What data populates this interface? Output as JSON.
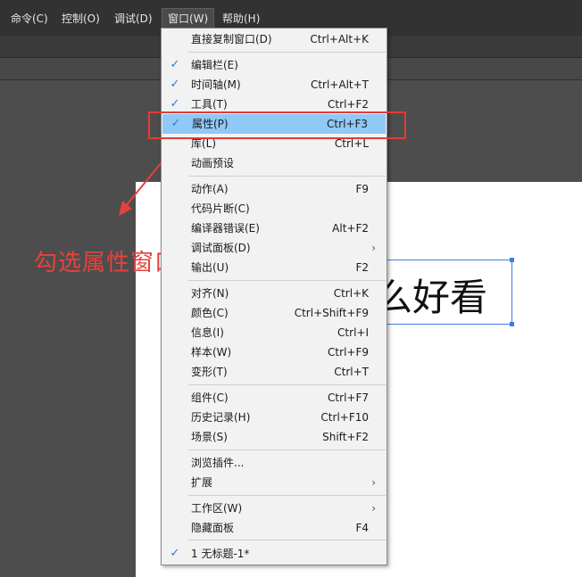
{
  "menubar": {
    "items": [
      {
        "label": "命令(C)"
      },
      {
        "label": "控制(O)"
      },
      {
        "label": "调试(D)"
      },
      {
        "label": "窗口(W)"
      },
      {
        "label": "帮助(H)"
      }
    ]
  },
  "stage": {
    "text": "么好看"
  },
  "annotation": {
    "text": "勾选属性窗口"
  },
  "colors": {
    "highlight": "#90c8f6",
    "annotation": "#e8413b",
    "check": "#2b79d8"
  },
  "dropdown": {
    "items": [
      {
        "label": "直接复制窗口(D)",
        "shortcut": "Ctrl+Alt+K",
        "checked": false
      },
      {
        "label": "编辑栏(E)",
        "shortcut": "",
        "checked": true
      },
      {
        "label": "时间轴(M)",
        "shortcut": "Ctrl+Alt+T",
        "checked": true
      },
      {
        "label": "工具(T)",
        "shortcut": "Ctrl+F2",
        "checked": true
      },
      {
        "label": "属性(P)",
        "shortcut": "Ctrl+F3",
        "checked": true,
        "highlighted": true
      },
      {
        "label": "库(L)",
        "shortcut": "Ctrl+L",
        "checked": false
      },
      {
        "label": "动画预设",
        "shortcut": "",
        "checked": false
      },
      {
        "label": "动作(A)",
        "shortcut": "F9",
        "checked": false
      },
      {
        "label": "代码片断(C)",
        "shortcut": "",
        "checked": false
      },
      {
        "label": "编译器错误(E)",
        "shortcut": "Alt+F2",
        "checked": false
      },
      {
        "label": "调试面板(D)",
        "shortcut": "",
        "checked": false,
        "submenu": true
      },
      {
        "label": "输出(U)",
        "shortcut": "F2",
        "checked": false
      },
      {
        "label": "对齐(N)",
        "shortcut": "Ctrl+K",
        "checked": false
      },
      {
        "label": "颜色(C)",
        "shortcut": "Ctrl+Shift+F9",
        "checked": false
      },
      {
        "label": "信息(I)",
        "shortcut": "Ctrl+I",
        "checked": false
      },
      {
        "label": "样本(W)",
        "shortcut": "Ctrl+F9",
        "checked": false
      },
      {
        "label": "变形(T)",
        "shortcut": "Ctrl+T",
        "checked": false
      },
      {
        "label": "组件(C)",
        "shortcut": "Ctrl+F7",
        "checked": false
      },
      {
        "label": "历史记录(H)",
        "shortcut": "Ctrl+F10",
        "checked": false
      },
      {
        "label": "场景(S)",
        "shortcut": "Shift+F2",
        "checked": false
      },
      {
        "label": "浏览插件...",
        "shortcut": "",
        "checked": false
      },
      {
        "label": "扩展",
        "shortcut": "",
        "checked": false,
        "submenu": true
      },
      {
        "label": "工作区(W)",
        "shortcut": "",
        "checked": false,
        "submenu": true
      },
      {
        "label": "隐藏面板",
        "shortcut": "F4",
        "checked": false
      },
      {
        "label": "1 无标题-1*",
        "shortcut": "",
        "checked": true
      }
    ]
  }
}
